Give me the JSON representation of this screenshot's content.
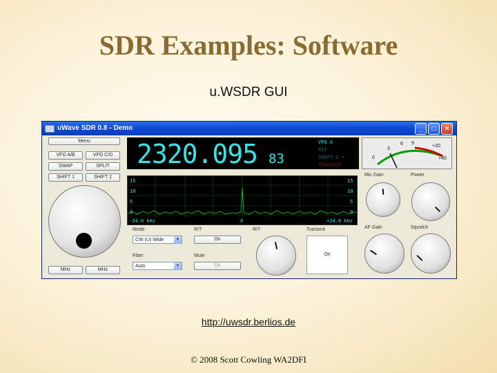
{
  "slide": {
    "title": "SDR Examples: Software",
    "subtitle": "u.WSDR GUI",
    "link": "http://uwsdr.berlios.de",
    "footer": "© 2008 Scott Cowling WA2DFI"
  },
  "window": {
    "title": "uWave SDR 0.8 - Demo",
    "controls": [
      "_",
      "□",
      "×"
    ]
  },
  "buttons": {
    "menu": "Menu",
    "vfo_ab": "VFO A/B",
    "vfo_ba": "VFO C/D",
    "swap": "SWAP",
    "split": "SPLIT",
    "shift1": "SHIFT 1",
    "shift2": "SHIFT 2",
    "mhz_down": "MHz",
    "mhz_up": "MHz"
  },
  "display": {
    "frequency": "2320.095",
    "frequency_small": "83",
    "vfo_labels": [
      {
        "text": "VFO A",
        "color": "#38e3e3"
      },
      {
        "text": "RIT",
        "color": "#1d6a6a"
      },
      {
        "text": "SHIFT 2 +",
        "color": "#1d6a6a"
      },
      {
        "text": "TRANSMIT",
        "color": "#6a1d1d"
      }
    ]
  },
  "meter": {
    "scale": [
      "0",
      "3",
      "6",
      "9",
      "+20",
      "+40"
    ]
  },
  "spectrum": {
    "left_scale": [
      "15",
      "10",
      "5",
      "0"
    ],
    "right_scale": [
      "15",
      "10",
      "5",
      "0"
    ],
    "left_freq": "-24.0 kHz",
    "center_freq": "0",
    "right_freq": "+24.0 kHz"
  },
  "controls": {
    "mode_label": "Mode",
    "mode_value": "CW (U) Wide",
    "filter_label": "Filter",
    "filter_value": "Auto",
    "rit_label": "RIT",
    "rit_button": "On",
    "mute_label": "Mute",
    "mute_button": "On",
    "rit_knob_label": "RIT",
    "transmit_label": "Transmit",
    "transmit_button": "On",
    "mic_gain_label": "Mic Gain",
    "power_label": "Power",
    "af_gain_label": "AF Gain",
    "squelch_label": "Squelch"
  }
}
